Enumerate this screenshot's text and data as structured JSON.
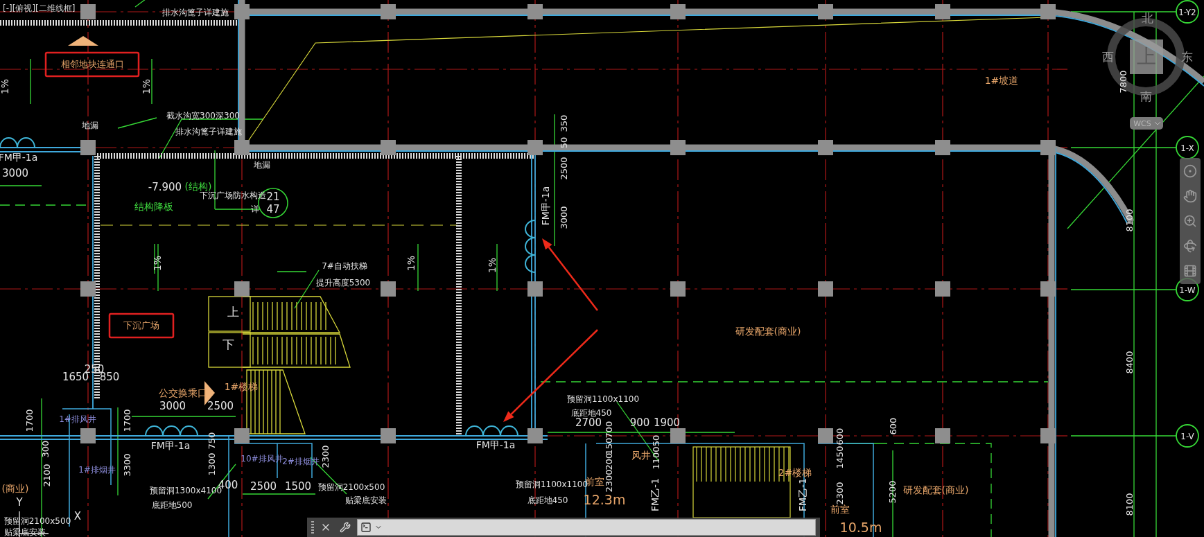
{
  "viewport_label": "[-][俯视][二维线框]",
  "annotations": [
    {
      "text": "排水沟篦子详建施",
      "kind": "note"
    },
    {
      "text": "相邻地块连通口",
      "kind": "boxed"
    },
    {
      "text": "1%",
      "kind": "slope"
    },
    {
      "text": "1%",
      "kind": "slope"
    },
    {
      "text": "地漏",
      "kind": "note"
    },
    {
      "text": "截水沟宽300深300",
      "kind": "note"
    },
    {
      "text": "排水沟篦子详建施",
      "kind": "note"
    },
    {
      "text": "FM甲-1a",
      "kind": "door"
    },
    {
      "text": "3000",
      "kind": "dim"
    },
    {
      "text": "-7.900",
      "kind": "dim"
    },
    {
      "text": "(结构)",
      "kind": "green"
    },
    {
      "text": "结构降板",
      "kind": "green"
    },
    {
      "text": "地漏",
      "kind": "note"
    },
    {
      "text": "下沉广场防水构造",
      "kind": "note"
    },
    {
      "text": "详",
      "kind": "note"
    },
    {
      "text": "21",
      "kind": "ref"
    },
    {
      "text": "47",
      "kind": "ref"
    },
    {
      "text": "7#自动扶梯",
      "kind": "note"
    },
    {
      "text": "提升高度5300",
      "kind": "note"
    },
    {
      "text": "1%",
      "kind": "slope"
    },
    {
      "text": "1%",
      "kind": "slope"
    },
    {
      "text": "1%",
      "kind": "slope"
    },
    {
      "text": "上",
      "kind": "stairdir"
    },
    {
      "text": "下",
      "kind": "stairdir"
    },
    {
      "text": "下沉广场",
      "kind": "boxed"
    },
    {
      "text": "1#楼梯",
      "kind": "room"
    },
    {
      "text": "公交换乘口",
      "kind": "room"
    },
    {
      "text": "1650",
      "kind": "dim"
    },
    {
      "text": "250",
      "kind": "dim"
    },
    {
      "text": "850",
      "kind": "dim"
    },
    {
      "text": "3000",
      "kind": "dim"
    },
    {
      "text": "2500",
      "kind": "dim"
    },
    {
      "text": "1700",
      "kind": "dimv"
    },
    {
      "text": "1700",
      "kind": "dimv"
    },
    {
      "text": "1#排风井",
      "kind": "shaft"
    },
    {
      "text": "FM甲-1a",
      "kind": "door"
    },
    {
      "text": "300",
      "kind": "dimv"
    },
    {
      "text": "750",
      "kind": "dimv"
    },
    {
      "text": "1300",
      "kind": "dimv"
    },
    {
      "text": "1#排烟井",
      "kind": "shaft"
    },
    {
      "text": "3300",
      "kind": "dimv"
    },
    {
      "text": "2100",
      "kind": "dimv"
    },
    {
      "text": "10#排风井",
      "kind": "shaft"
    },
    {
      "text": "2#排烟井",
      "kind": "shaft"
    },
    {
      "text": "2300",
      "kind": "dimv"
    },
    {
      "text": "预留洞1300x4100",
      "kind": "note"
    },
    {
      "text": "400",
      "kind": "dim"
    },
    {
      "text": "底距地500",
      "kind": "note"
    },
    {
      "text": "2500",
      "kind": "dim"
    },
    {
      "text": "1500",
      "kind": "dim"
    },
    {
      "text": "预留洞2100x500",
      "kind": "note"
    },
    {
      "text": "贴梁底安装",
      "kind": "note"
    },
    {
      "text": "(商业)",
      "kind": "room"
    },
    {
      "text": "Y",
      "kind": "ucs"
    },
    {
      "text": "X",
      "kind": "ucs"
    },
    {
      "text": "预留洞2100x500",
      "kind": "note"
    },
    {
      "text": "贴梁底安装",
      "kind": "note"
    },
    {
      "text": "FM甲-1a",
      "kind": "doorv"
    },
    {
      "text": "350",
      "kind": "dimv"
    },
    {
      "text": "50",
      "kind": "dimv"
    },
    {
      "text": "2500",
      "kind": "dimv"
    },
    {
      "text": "3000",
      "kind": "dimv"
    },
    {
      "text": "FM甲-1a",
      "kind": "door"
    },
    {
      "text": "预留洞1100x1100",
      "kind": "note"
    },
    {
      "text": "底距地450",
      "kind": "note"
    },
    {
      "text": "2700",
      "kind": "dim"
    },
    {
      "text": "900",
      "kind": "dim"
    },
    {
      "text": "1900",
      "kind": "dim"
    },
    {
      "text": "700",
      "kind": "dimv"
    },
    {
      "text": "150",
      "kind": "dimv"
    },
    {
      "text": "200",
      "kind": "dimv"
    },
    {
      "text": "2300",
      "kind": "dimv"
    },
    {
      "text": "50",
      "kind": "dimv"
    },
    {
      "text": "1100",
      "kind": "dimv"
    },
    {
      "text": "风井",
      "kind": "room"
    },
    {
      "text": "前室",
      "kind": "room"
    },
    {
      "text": "12.3m",
      "kind": "big"
    },
    {
      "text": "预留洞1100x1100",
      "kind": "note"
    },
    {
      "text": "底距地450",
      "kind": "note"
    },
    {
      "text": "FM乙-1",
      "kind": "doorv"
    },
    {
      "text": "2#楼梯",
      "kind": "room"
    },
    {
      "text": "FM乙-1",
      "kind": "doorv"
    },
    {
      "text": "600",
      "kind": "dimv"
    },
    {
      "text": "1450",
      "kind": "dimv"
    },
    {
      "text": "2300",
      "kind": "dimv"
    },
    {
      "text": "前室",
      "kind": "room"
    },
    {
      "text": "10.5m",
      "kind": "big"
    },
    {
      "text": "1#坡道",
      "kind": "room"
    },
    {
      "text": "研发配套(商业)",
      "kind": "room"
    },
    {
      "text": "研发配套(商业)",
      "kind": "room"
    },
    {
      "text": "7800",
      "kind": "dimv"
    },
    {
      "text": "8100",
      "kind": "dimv"
    },
    {
      "text": "8400",
      "kind": "dimv"
    },
    {
      "text": "8100",
      "kind": "dimv"
    },
    {
      "text": "600",
      "kind": "dimv"
    },
    {
      "text": "5200",
      "kind": "dimv"
    }
  ],
  "axis_bubbles": [
    {
      "text": "1-Y2"
    },
    {
      "text": "1-X"
    },
    {
      "text": "1-W"
    },
    {
      "text": "1-V"
    }
  ],
  "compass": {
    "north": "北",
    "west": "西",
    "east": "东",
    "south": "南",
    "top": "上",
    "badge": "WCS"
  }
}
